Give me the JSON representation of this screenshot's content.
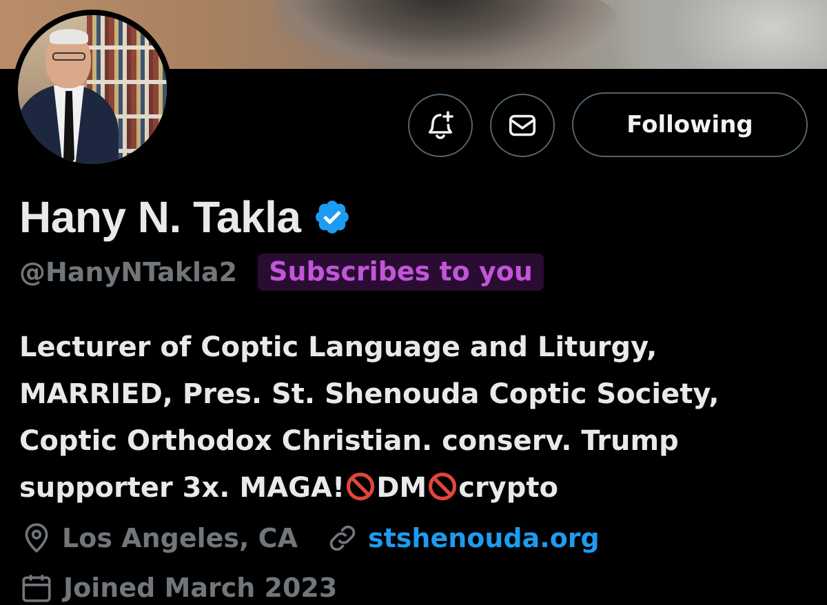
{
  "profile": {
    "name": "Hany N. Takla",
    "handle": "@HanyNTakla2",
    "badge": "Subscribes to you",
    "bio_lines": [
      "Lecturer of Coptic Language and Liturgy,",
      "MARRIED, Pres. St. Shenouda Coptic Society,",
      "Coptic Orthodox Christian. conserv. Trump",
      "supporter 3x. MAGA!"
    ],
    "bio_tail": [
      "DM",
      "crypto"
    ],
    "location": "Los Angeles, CA",
    "website": "stshenouda.org",
    "joined": "Joined March 2023"
  },
  "actions": {
    "following_label": "Following"
  },
  "colors": {
    "background": "#000000",
    "muted": "#71767b",
    "link": "#1d9bf0",
    "badge_bg": "#2a0c33",
    "badge_text": "#c255d9",
    "verified": "#1d9bf0"
  }
}
